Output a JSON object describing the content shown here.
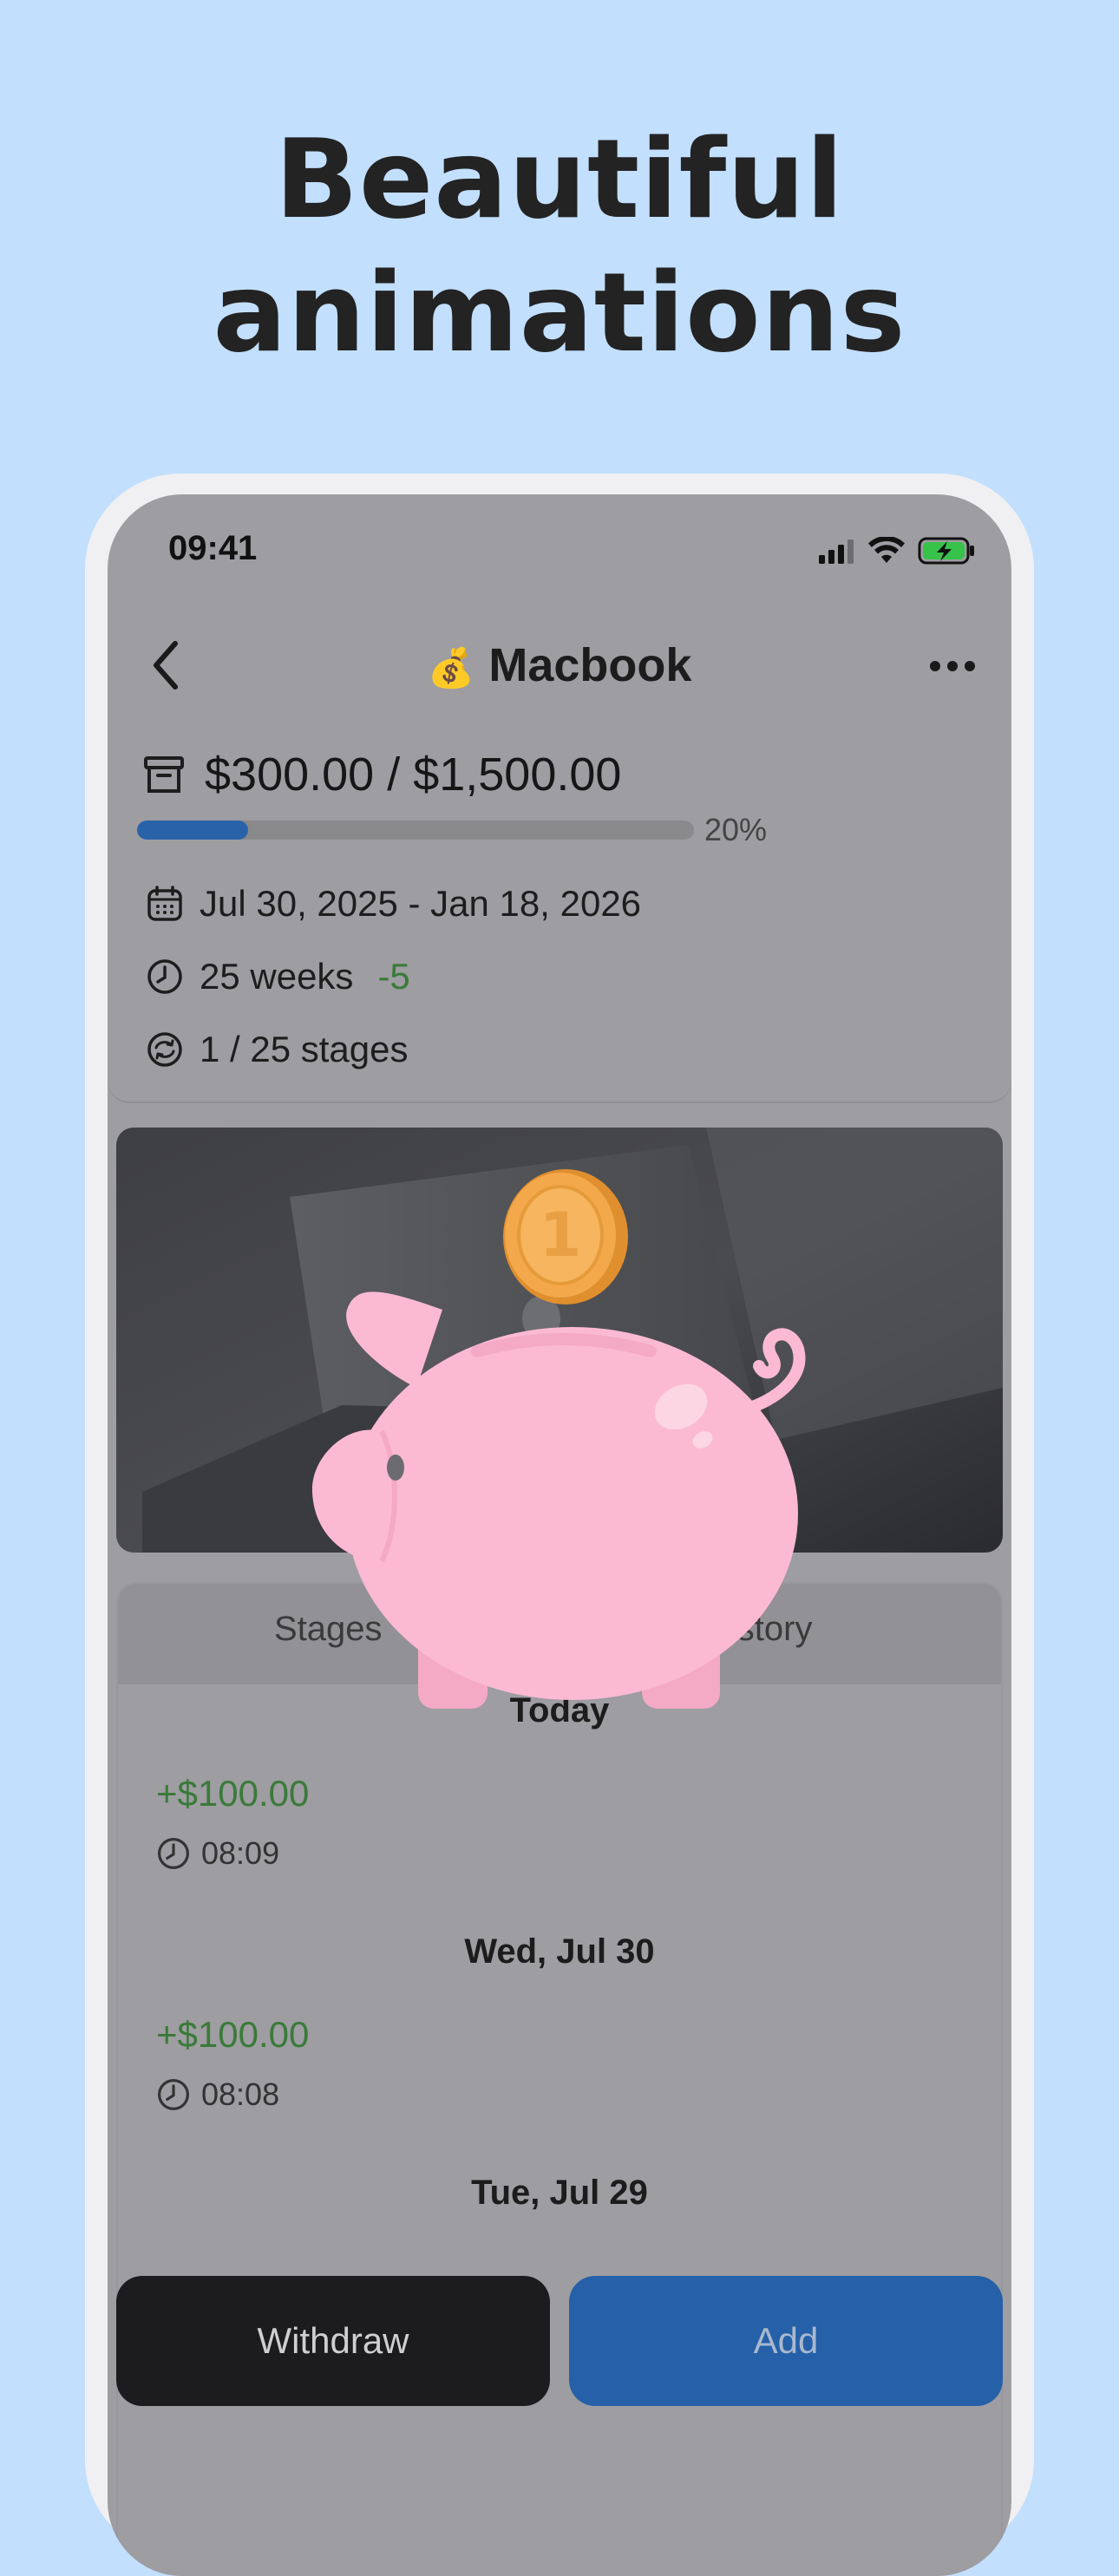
{
  "headline": {
    "line1": "Beautiful",
    "line2": "animations"
  },
  "status_bar": {
    "time": "09:41"
  },
  "nav": {
    "emoji": "💰",
    "title": "Macbook"
  },
  "goal": {
    "amount_text": "$300.00 / $1,500.00",
    "progress_fraction": 0.2,
    "progress_label": "20%",
    "date_range": "Jul 30, 2025 - Jan 18, 2026",
    "duration": "25 weeks",
    "duration_delta": "-5",
    "stages": "1 / 25 stages"
  },
  "tabs": [
    {
      "label": "Stages"
    },
    {
      "label": "History"
    }
  ],
  "history": [
    {
      "day": "Today",
      "amount": "+$100.00",
      "time": "08:09"
    },
    {
      "day": "Wed, Jul 30",
      "amount": "+$100.00",
      "time": "08:08"
    },
    {
      "day": "Tue, Jul 29"
    }
  ],
  "actions": {
    "withdraw": "Withdraw",
    "add": "Add"
  },
  "coin_label": "1",
  "colors": {
    "background": "#c2dffe",
    "accent": "#2560a8",
    "positive": "#3a7a3a",
    "pig": "#fbbad2",
    "coin": "#f3a94b"
  }
}
